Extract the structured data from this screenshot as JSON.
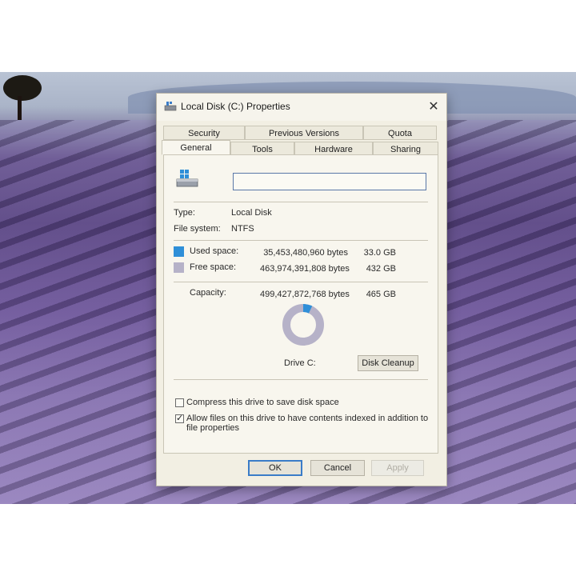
{
  "window": {
    "title": "Local Disk (C:) Properties",
    "close_glyph": "✕"
  },
  "tabs": {
    "row_top": [
      "Security",
      "Previous Versions",
      "Quota"
    ],
    "row_bottom": [
      "General",
      "Tools",
      "Hardware",
      "Sharing"
    ],
    "active": "General"
  },
  "general": {
    "drive_name_value": "",
    "type_label": "Type:",
    "type_value": "Local Disk",
    "fs_label": "File system:",
    "fs_value": "NTFS",
    "used_label": "Used space:",
    "used_bytes": "35,453,480,960 bytes",
    "used_size": "33.0 GB",
    "free_label": "Free space:",
    "free_bytes": "463,974,391,808 bytes",
    "free_size": "432 GB",
    "capacity_label": "Capacity:",
    "capacity_bytes": "499,427,872,768 bytes",
    "capacity_size": "465 GB",
    "used_fraction": 0.071,
    "drive_label": "Drive C:",
    "cleanup_button": "Disk Cleanup",
    "compress_label": "Compress this drive to save disk space",
    "compress_checked": false,
    "index_label_line1": "Allow files on this drive to have contents indexed in addition to",
    "index_label_line2": "file properties",
    "index_checked": true
  },
  "footer": {
    "ok": "OK",
    "cancel": "Cancel",
    "apply": "Apply"
  },
  "colors": {
    "used": "#2f8fd8",
    "free": "#b6b2c8",
    "accent": "#3a7cc8"
  },
  "icons": {
    "title_icon": "drive-icon",
    "drive_icon": "windows-drive-icon",
    "close": "close-icon"
  }
}
